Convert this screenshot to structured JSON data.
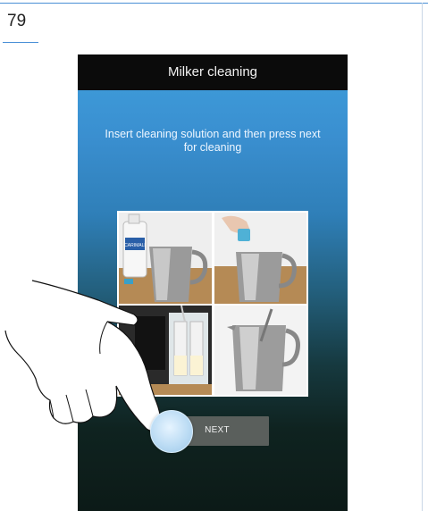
{
  "page": {
    "number": "79"
  },
  "screen": {
    "title": "Milker cleaning",
    "instruction": "Insert cleaning solution and then press next for cleaning",
    "photos": [
      {
        "label": "CARIMALI"
      }
    ],
    "next_button": {
      "label": "NEXT"
    }
  },
  "colors": {
    "accent_rule": "#4a90d6",
    "header_bg": "#0b0b0b",
    "button_bg": "#5a5f5c"
  },
  "icons": [
    "hand-pointer-icon",
    "touch-indicator-icon"
  ]
}
